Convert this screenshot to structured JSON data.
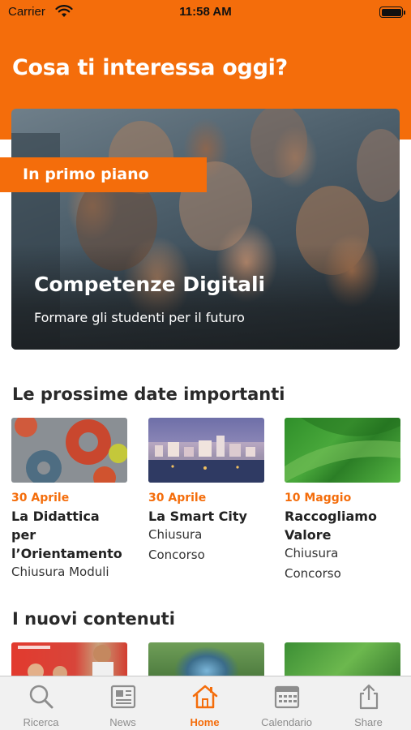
{
  "status_bar": {
    "carrier": "Carrier",
    "time": "11:58 AM"
  },
  "header": {
    "title": "Cosa ti interessa oggi?"
  },
  "featured": {
    "badge": "In primo piano",
    "title": "Competenze Digitali",
    "subtitle": "Formare gli studenti per il futuro"
  },
  "dates_section": {
    "title": "Le prossime date importanti",
    "events": [
      {
        "date": "30 Aprile",
        "title": "La Didattica per l’Orientamento",
        "lines": [
          "Chiusura Moduli"
        ]
      },
      {
        "date": "30 Aprile",
        "title": "La Smart City",
        "lines": [
          "Chiusura",
          "Concorso"
        ]
      },
      {
        "date": "10 Maggio",
        "title": "Raccogliamo Valore",
        "lines": [
          "Chiusura",
          "Concorso"
        ]
      }
    ]
  },
  "content_section": {
    "title": "I nuovi contenuti"
  },
  "tab_bar": {
    "active": "Home",
    "accent_color": "#f46d0b",
    "items": [
      {
        "label": "Ricerca",
        "icon": "search-icon"
      },
      {
        "label": "News",
        "icon": "newspaper-icon"
      },
      {
        "label": "Home",
        "icon": "home-icon"
      },
      {
        "label": "Calendario",
        "icon": "calendar-icon"
      },
      {
        "label": "Share",
        "icon": "share-icon"
      }
    ]
  }
}
